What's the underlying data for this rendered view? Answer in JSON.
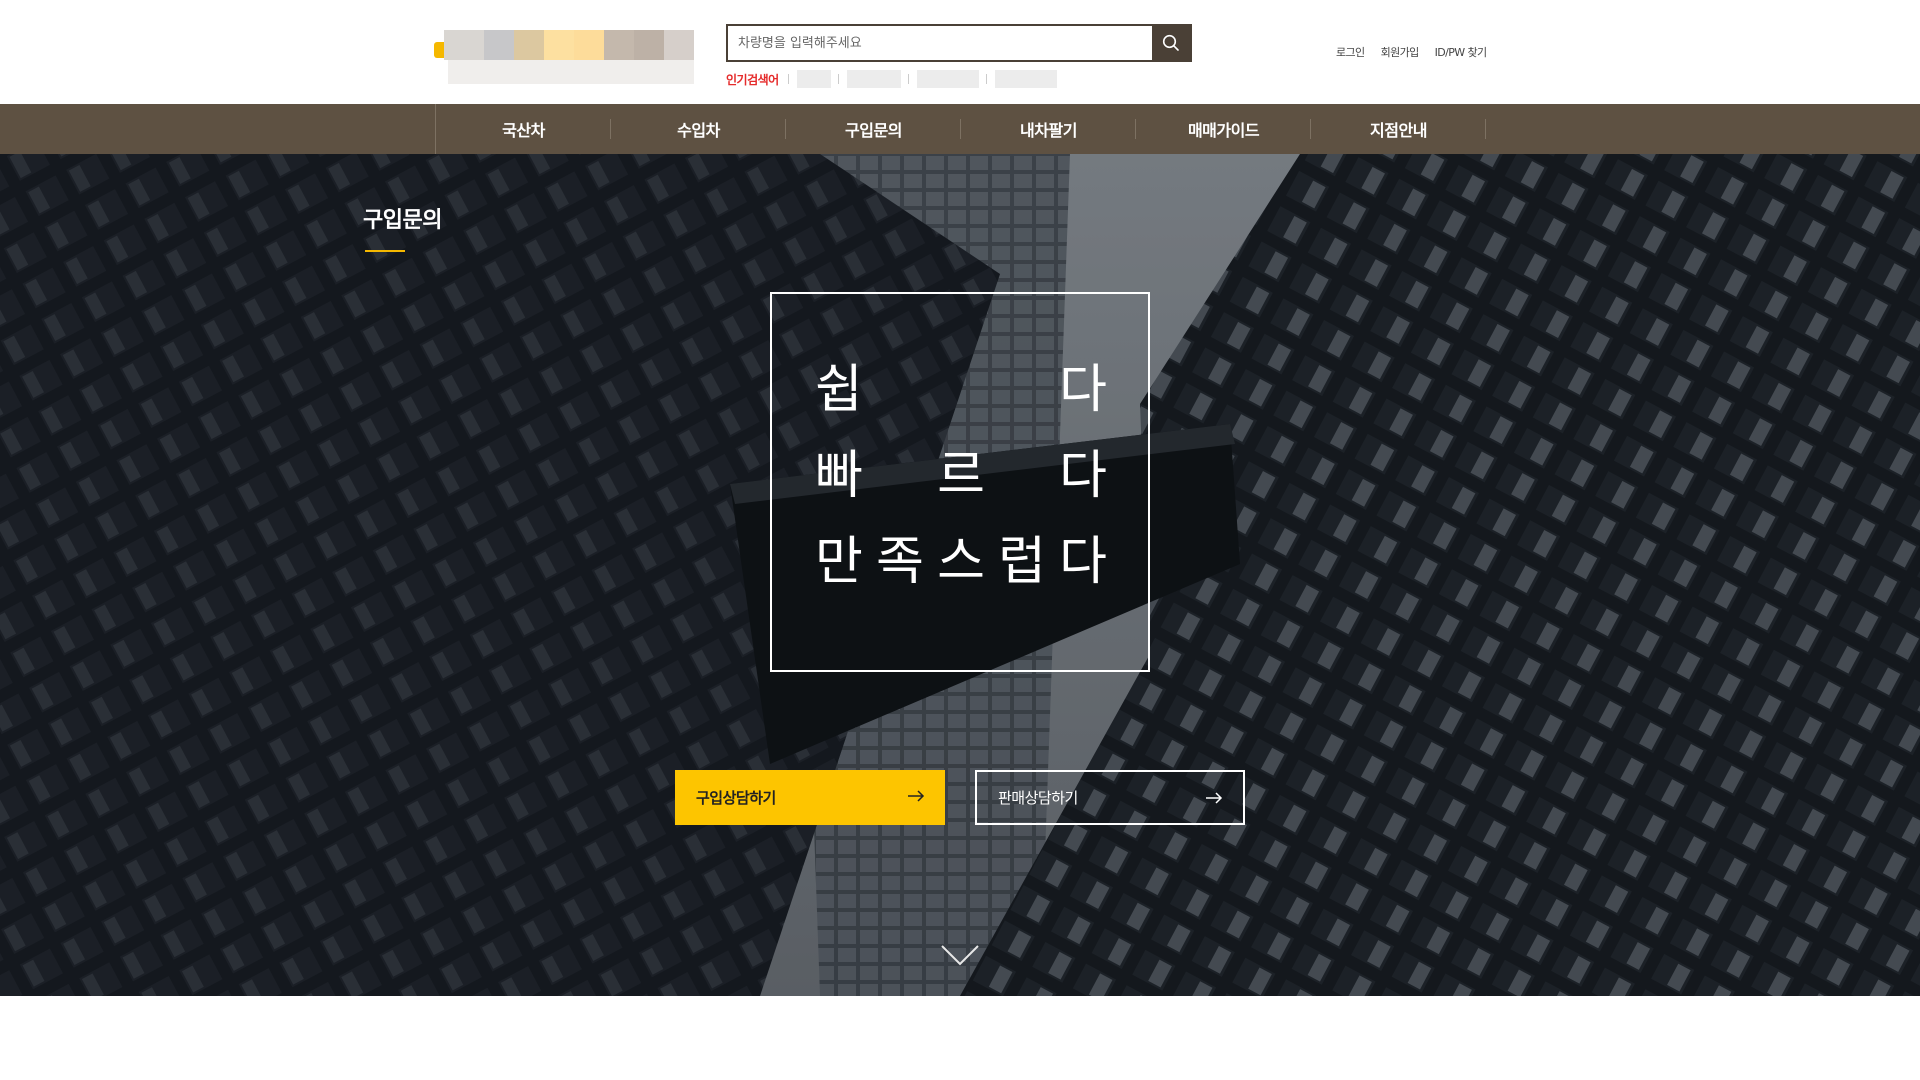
{
  "header": {
    "search": {
      "placeholder": "차량명을 입력해주세요"
    },
    "popular_label": "인기검색어",
    "util_links": [
      "로그인",
      "회원가입",
      "ID/PW 찾기"
    ]
  },
  "gnb": {
    "items": [
      "국산차",
      "수입차",
      "구입문의",
      "내차팔기",
      "매매가이드",
      "지점안내"
    ]
  },
  "hero": {
    "page_title": "구입문의",
    "slogan": {
      "line1": [
        "쉽",
        "다"
      ],
      "line2": [
        "빠",
        "르",
        "다"
      ],
      "line3": [
        "만",
        "족",
        "스",
        "럽",
        "다"
      ]
    },
    "buttons": {
      "buy": "구입상담하기",
      "sell": "판매상담하기"
    }
  },
  "colors": {
    "gnb_bg": "#5e5142",
    "accent": "#fdc500",
    "popular_red": "#e52b2b",
    "search_border": "#4a4036"
  },
  "icons": {
    "search": "search-icon",
    "arrow": "arrow-right-icon",
    "scroll": "chevron-down-icon"
  }
}
